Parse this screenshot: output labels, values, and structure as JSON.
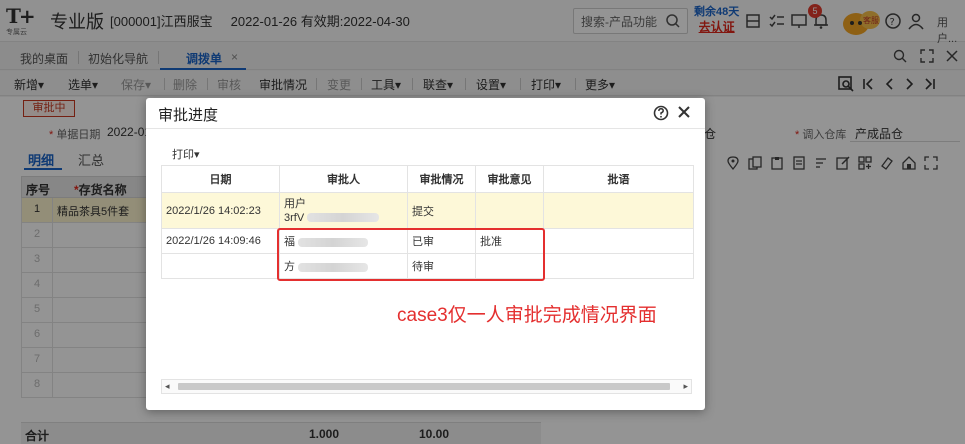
{
  "header": {
    "logo_text": "T+",
    "logo_sub": "专属云",
    "edition": "专业版",
    "company": "[000001]江西服宝",
    "date_info": "2022-01-26  有效期:2022-04-30",
    "search_placeholder": "搜索-产品功能",
    "trial_days": "剩余48天",
    "certify": "去认证",
    "notification_count": "5",
    "mascot_label": "客服",
    "user": "用户..."
  },
  "tabs": [
    {
      "label": "我的桌面"
    },
    {
      "label": "初始化导航"
    },
    {
      "label": "调拨单",
      "close": "×"
    }
  ],
  "toolbar": {
    "new": "新增",
    "select": "选单",
    "save": "保存",
    "delete": "删除",
    "audit": "审核",
    "approval_status": "审批情况",
    "change": "变更",
    "tools": "工具",
    "linked_query": "联查",
    "settings": "设置",
    "print": "打印",
    "more": "更多",
    "dropdown_arrow": "▾"
  },
  "form": {
    "status": "审批中",
    "doc_date_label": "单据日期",
    "doc_date_value": "2022-01",
    "in_warehouse_label": "调入仓库",
    "in_warehouse_value": "产成品仓",
    "right_fragment": "仓",
    "subtab_detail": "明细",
    "subtab_summary": "汇总",
    "grid_headers": {
      "seq": "序号",
      "item": "存货名称"
    },
    "grid_rows": [
      {
        "n": "1",
        "name": "精品茶具5件套"
      },
      {
        "n": "2",
        "name": ""
      },
      {
        "n": "3",
        "name": ""
      },
      {
        "n": "4",
        "name": ""
      },
      {
        "n": "5",
        "name": ""
      },
      {
        "n": "6",
        "name": ""
      },
      {
        "n": "7",
        "name": ""
      },
      {
        "n": "8",
        "name": ""
      }
    ],
    "total_label": "合计",
    "total_qty": "1.000",
    "total_amount": "10.00"
  },
  "dialog": {
    "title": "审批进度",
    "print": "打印",
    "columns": [
      "日期",
      "审批人",
      "审批情况",
      "审批意见",
      "批语"
    ],
    "rows": [
      {
        "date": "2022/1/26 14:02:23",
        "approver_line1": "用户",
        "approver_line2": "3rfV",
        "status": "提交",
        "opinion": "",
        "comment": ""
      },
      {
        "date": "2022/1/26 14:09:46",
        "approver_line1": "福",
        "approver_line2": "",
        "status": "已审",
        "opinion": "批准",
        "comment": ""
      },
      {
        "date": "",
        "approver_line1": "方",
        "approver_line2": "",
        "status": "待审",
        "opinion": "",
        "comment": ""
      }
    ]
  },
  "annotation": "case3仅一人审批完成情况界面",
  "colors": {
    "accent": "#1b64c8",
    "annotation_red": "#e42f2f",
    "highlight_row": "#fdf8d8"
  }
}
